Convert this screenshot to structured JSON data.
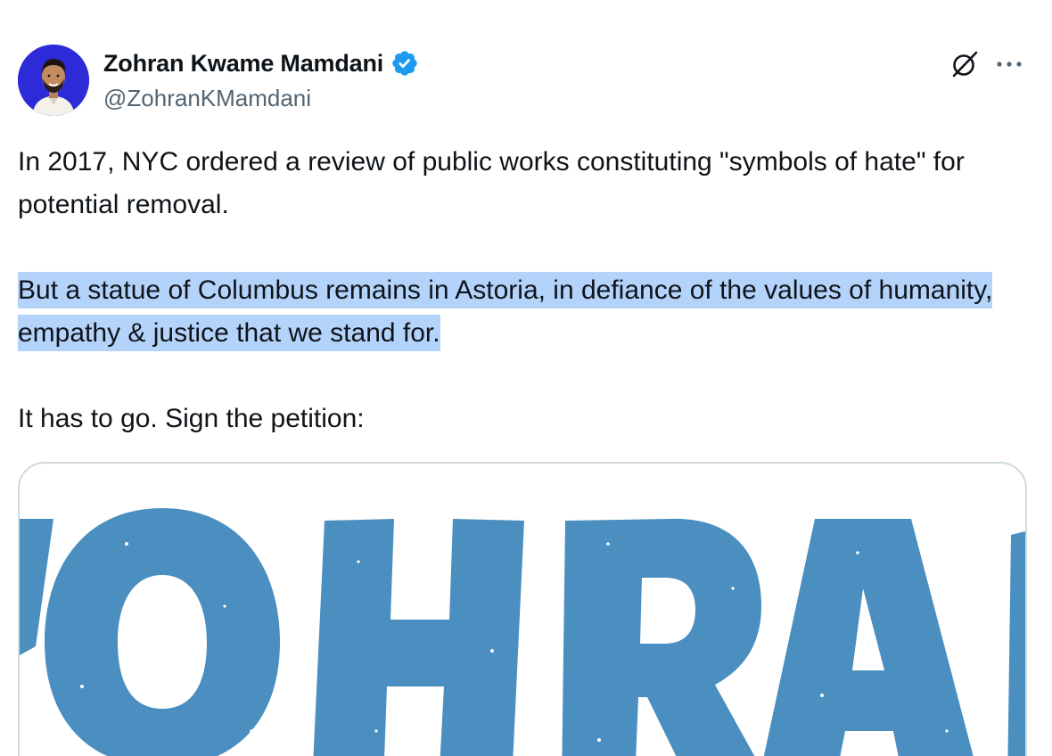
{
  "author": {
    "display_name": "Zohran Kwame Mamdani",
    "handle": "@ZohranKMamdani",
    "verified": true,
    "verified_icon": "verified-badge-icon",
    "avatar_bg": "#2d2bd8"
  },
  "actions": {
    "grok_icon": "grok-icon",
    "more_icon": "more-icon"
  },
  "tweet": {
    "paragraph_1": "In 2017, NYC ordered a review of public works constituting \"symbols of hate\" for potential removal.",
    "paragraph_2": "But a statue of Columbus remains in Astoria, in defiance of the values of humanity, empathy & justice that we stand for.",
    "paragraph_3": "It has to go. Sign the petition:"
  },
  "card": {
    "image_text": "ZOHRAN",
    "image_color": "#4a8fc0"
  },
  "colors": {
    "highlight": "#b4d3fb",
    "verified": "#1d9bf0",
    "secondary_text": "#536471",
    "border": "#cfd9de"
  }
}
